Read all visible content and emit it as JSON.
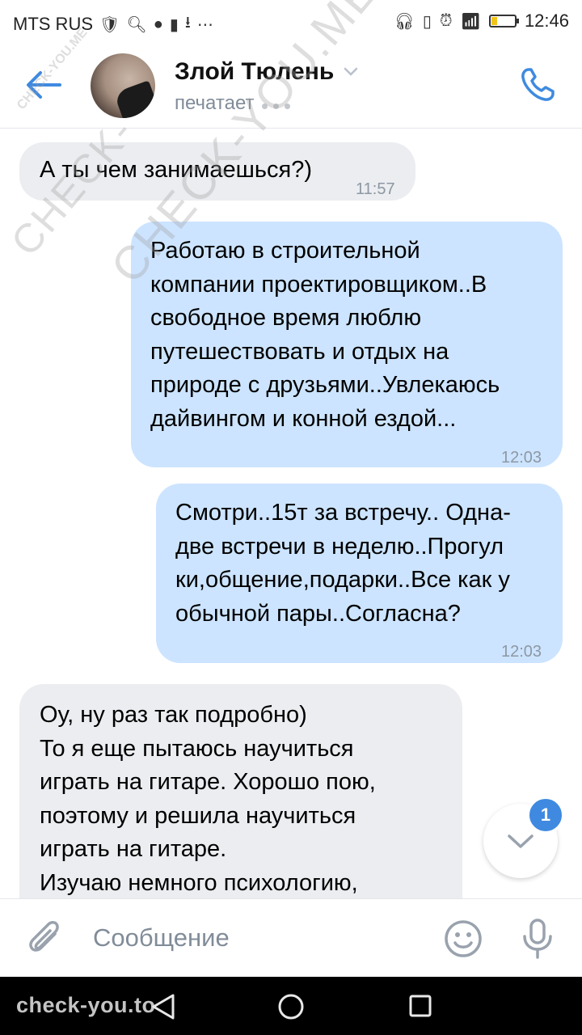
{
  "status_bar": {
    "carrier": "MTS RUS",
    "time": "12:46",
    "battery_level": 0.25
  },
  "header": {
    "contact_name": "Злой Тюлень",
    "status": "печатает"
  },
  "messages": [
    {
      "direction": "incoming",
      "text": "А ты чем занимаешься?)",
      "time": "11:57"
    },
    {
      "direction": "outgoing",
      "text": "Работаю в строительной\nкомпании проектировщиком..В\nсвободное время люблю\nпутешествовать и отдых на\nприроде с друзьями..Увлекаюсь\nдайвингом и конной ездой...",
      "time": "12:03"
    },
    {
      "direction": "outgoing",
      "text": "Смотри..15т за встречу.. Одна-\nдве встречи в неделю..Прогул\nки,общение,подарки..Все как у\nобычной пары..Согласна?",
      "time": "12:03"
    },
    {
      "direction": "incoming",
      "text": "Оу, ну раз так подробно)\nТо я еще пытаюсь научиться\nиграть на гитаре. Хорошо пою,\nпоэтому и решила научиться\nиграть на гитаре.\nИзучаю немного психологию,",
      "time": ""
    }
  ],
  "scroll_down": {
    "unread_count": "1"
  },
  "composer": {
    "placeholder": "Сообщение"
  },
  "watermarks": {
    "small": "CHECK-YOU.ME",
    "large": "CHECK-YOU.ME",
    "large_left": "CHECK-",
    "nav": "check-you.to"
  },
  "icons": {
    "back": "arrow-left-icon",
    "call": "phone-icon",
    "chevron": "chevron-down-icon",
    "attach": "paperclip-icon",
    "emoji": "smile-icon",
    "mic": "microphone-icon"
  },
  "colors": {
    "accent": "#3f8ae0",
    "incoming_bubble": "#ebedf0",
    "outgoing_bubble": "#cce4ff"
  }
}
